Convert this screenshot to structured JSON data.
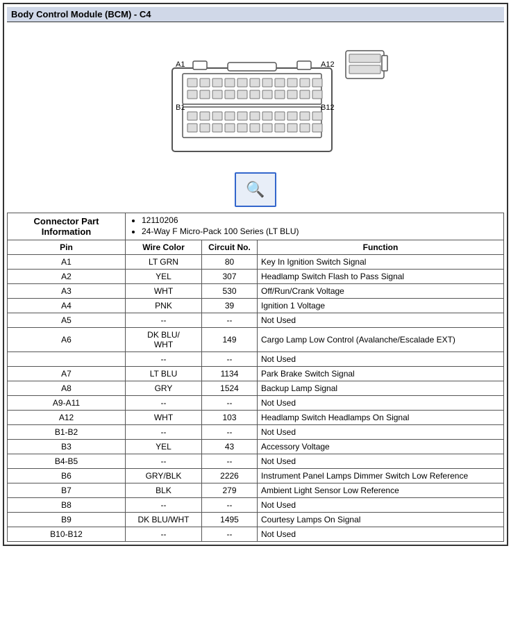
{
  "title": "Body Control Module (BCM) - C4",
  "connector_part_label": "Connector Part Information",
  "part_info": {
    "part_number": "12110206",
    "description": "24-Way F Micro-Pack 100 Series (LT BLU)"
  },
  "table_headers": {
    "pin": "Pin",
    "wire_color": "Wire Color",
    "circuit_no": "Circuit No.",
    "function": "Function"
  },
  "rows": [
    {
      "pin": "A1",
      "wire_color": "LT GRN",
      "circuit_no": "80",
      "function": "Key In Ignition Switch Signal"
    },
    {
      "pin": "A2",
      "wire_color": "YEL",
      "circuit_no": "307",
      "function": "Headlamp Switch Flash to Pass Signal"
    },
    {
      "pin": "A3",
      "wire_color": "WHT",
      "circuit_no": "530",
      "function": "Off/Run/Crank Voltage"
    },
    {
      "pin": "A4",
      "wire_color": "PNK",
      "circuit_no": "39",
      "function": "Ignition 1 Voltage"
    },
    {
      "pin": "A5",
      "wire_color": "--",
      "circuit_no": "--",
      "function": "Not Used"
    },
    {
      "pin": "A6",
      "wire_color": "DK BLU/\nWHT",
      "circuit_no": "149",
      "function": "Cargo Lamp Low Control (Avalanche/Escalade EXT)"
    },
    {
      "pin": "",
      "wire_color": "--",
      "circuit_no": "--",
      "function": "Not Used"
    },
    {
      "pin": "A7",
      "wire_color": "LT BLU",
      "circuit_no": "1134",
      "function": "Park Brake Switch Signal"
    },
    {
      "pin": "A8",
      "wire_color": "GRY",
      "circuit_no": "1524",
      "function": "Backup Lamp Signal"
    },
    {
      "pin": "A9-A11",
      "wire_color": "--",
      "circuit_no": "--",
      "function": "Not Used"
    },
    {
      "pin": "A12",
      "wire_color": "WHT",
      "circuit_no": "103",
      "function": "Headlamp Switch Headlamps On Signal"
    },
    {
      "pin": "B1-B2",
      "wire_color": "--",
      "circuit_no": "--",
      "function": "Not Used"
    },
    {
      "pin": "B3",
      "wire_color": "YEL",
      "circuit_no": "43",
      "function": "Accessory Voltage"
    },
    {
      "pin": "B4-B5",
      "wire_color": "--",
      "circuit_no": "--",
      "function": "Not Used"
    },
    {
      "pin": "B6",
      "wire_color": "GRY/BLK",
      "circuit_no": "2226",
      "function": "Instrument Panel Lamps Dimmer Switch Low Reference"
    },
    {
      "pin": "B7",
      "wire_color": "BLK",
      "circuit_no": "279",
      "function": "Ambient Light Sensor Low Reference"
    },
    {
      "pin": "B8",
      "wire_color": "--",
      "circuit_no": "--",
      "function": "Not Used"
    },
    {
      "pin": "B9",
      "wire_color": "DK BLU/WHT",
      "circuit_no": "1495",
      "function": "Courtesy Lamps On Signal"
    },
    {
      "pin": "B10-B12",
      "wire_color": "--",
      "circuit_no": "--",
      "function": "Not Used"
    }
  ]
}
